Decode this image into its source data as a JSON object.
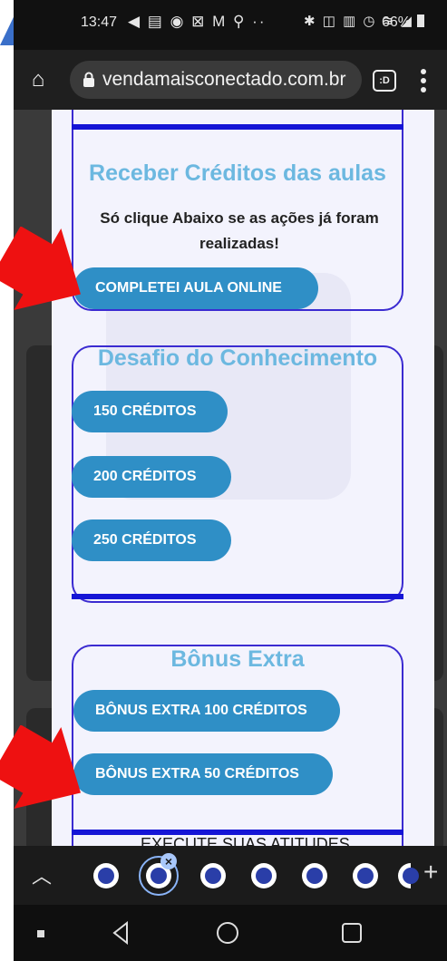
{
  "status_bar": {
    "time": "13:47",
    "left_icons": "◀ ▤ ◉ ⊠ M ⚲ ··",
    "right_icons": "✱ ◫ ▥ ◷ ≋ ◢",
    "battery": "66%"
  },
  "address_bar": {
    "url": "vendamaisconectado.com.br",
    "tab_switch_label": ":D"
  },
  "cards": {
    "receber": {
      "title": "Receber Créditos das aulas",
      "description": "Só clique Abaixo se as ações já foram realizadas!",
      "button": "COMPLETEI AULA ONLINE"
    },
    "desafio": {
      "title": "Desafio do Conhecimento",
      "buttons": [
        "150 CRÉDITOS",
        "200 CRÉDITOS",
        "250 CRÉDITOS"
      ]
    },
    "bonus": {
      "title": "Bônus Extra",
      "buttons": [
        "BÔNUS EXTRA 100 CRÉDITOS",
        "BÔNUS EXTRA 50 CRÉDITOS"
      ]
    }
  },
  "underlying_text": "EXECUTE SUAS ATITUDES",
  "tab_strip": {
    "tab_count_visible": 7,
    "active_tab_index": 1
  },
  "colors": {
    "button_blue": "#2f8fc6",
    "title_blue": "#6cb8e0",
    "card_border": "#3b2bd1",
    "accent_bar": "#1515d6",
    "arrow_red": "#ee1111"
  }
}
